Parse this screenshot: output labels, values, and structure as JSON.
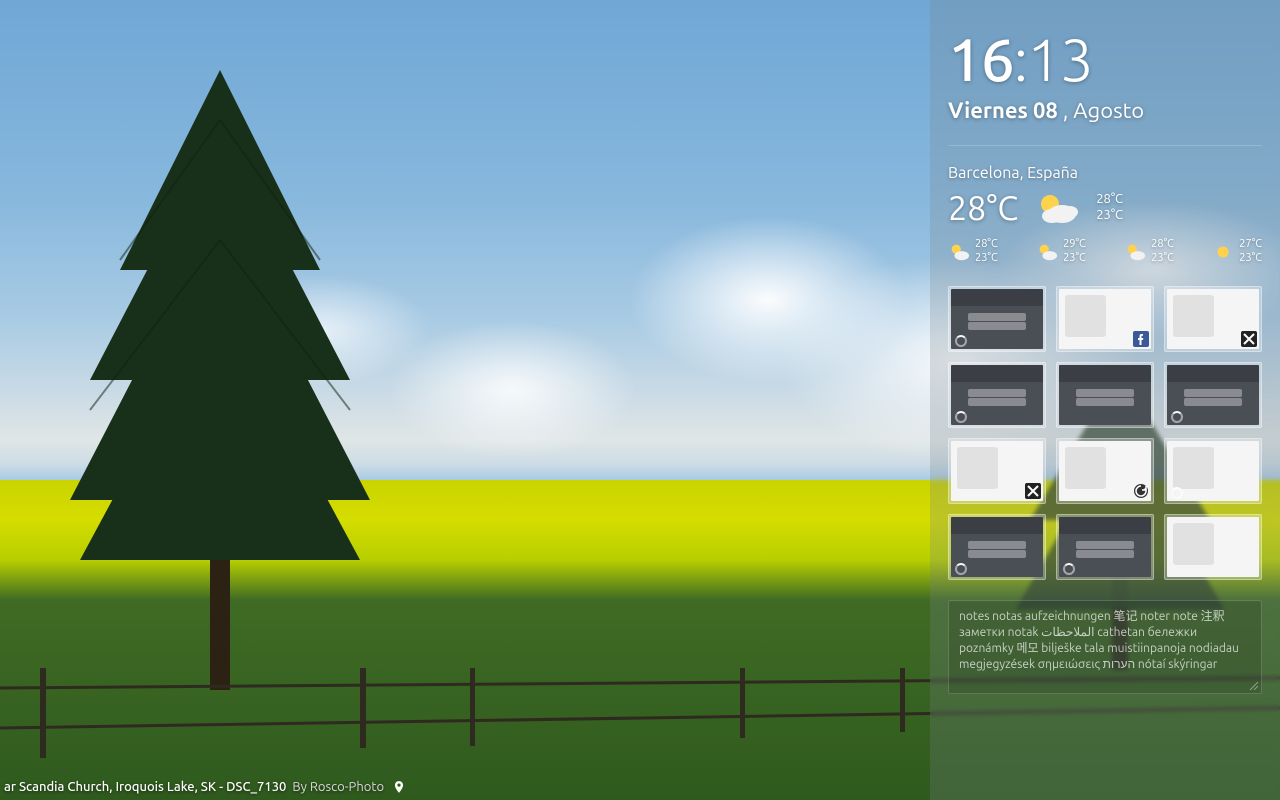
{
  "clock": {
    "hours": "16",
    "minutes": "13"
  },
  "date": {
    "day_of_week": "Viernes",
    "day_number": "08",
    "month": "Agosto"
  },
  "weather": {
    "location": "Barcelona, España",
    "current": {
      "temp": "28°C",
      "high": "28°C",
      "low": "23°C",
      "icon": "partly-cloudy"
    },
    "forecast": [
      {
        "high": "28°C",
        "low": "23°C",
        "icon": "partly-cloudy"
      },
      {
        "high": "29°C",
        "low": "23°C",
        "icon": "partly-cloudy"
      },
      {
        "high": "28°C",
        "low": "23°C",
        "icon": "partly-cloudy"
      },
      {
        "high": "27°C",
        "low": "23°C",
        "icon": "sunny"
      }
    ]
  },
  "speed_dial": [
    {
      "thumb": "dark",
      "loading": true,
      "badge": "none"
    },
    {
      "thumb": "light",
      "loading": false,
      "badge": "facebook"
    },
    {
      "thumb": "light",
      "loading": false,
      "badge": "x"
    },
    {
      "thumb": "dark",
      "loading": true,
      "badge": "none"
    },
    {
      "thumb": "dark",
      "loading": false,
      "badge": "none"
    },
    {
      "thumb": "dark",
      "loading": true,
      "badge": "none"
    },
    {
      "thumb": "light",
      "loading": false,
      "badge": "x"
    },
    {
      "thumb": "light",
      "loading": false,
      "badge": "refresh"
    },
    {
      "thumb": "light",
      "loading": true,
      "badge": "none"
    },
    {
      "thumb": "dark",
      "loading": true,
      "badge": "none"
    },
    {
      "thumb": "dark",
      "loading": true,
      "badge": "none"
    },
    {
      "thumb": "light",
      "loading": false,
      "badge": "none"
    }
  ],
  "notes": {
    "placeholder": "notes notas aufzeichnungen 笔记 noter note 注釈 заметки notak الملاحظات cathetan бележки poznámky 메모 bilješke tala muistiinpanoja nodiadau megjegyzések σημειώσεις הערות nótaí skýringar"
  },
  "attribution": {
    "title_prefix": "ar Scandia Church, Iroquois Lake, SK - DSC_7130",
    "by_label": "By",
    "author": "Rosco-Photo"
  }
}
